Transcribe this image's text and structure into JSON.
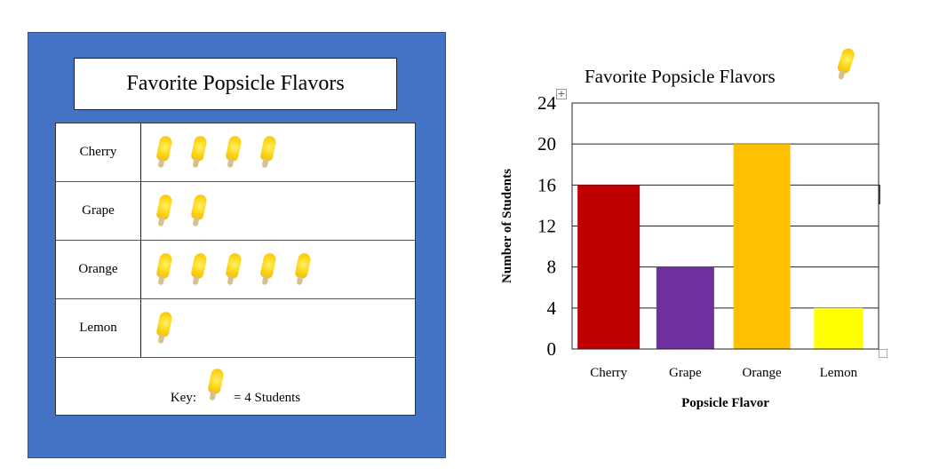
{
  "pictograph": {
    "title": "Favorite Popsicle Flavors",
    "background_color": "#4472c4",
    "icon": "popsicle-icon",
    "rows": [
      {
        "label": "Cherry",
        "icons": 4
      },
      {
        "label": "Grape",
        "icons": 2
      },
      {
        "label": "Orange",
        "icons": 5
      },
      {
        "label": "Lemon",
        "icons": 1
      }
    ],
    "key_prefix": "Key:",
    "key_suffix": "= 4 Students"
  },
  "chart_data": {
    "type": "bar",
    "title": "Favorite Popsicle Flavors",
    "title_icon": "popsicle-icon",
    "categories": [
      "Cherry",
      "Grape",
      "Orange",
      "Lemon"
    ],
    "values": [
      16,
      8,
      20,
      4
    ],
    "colors": [
      "#c00000",
      "#7030a0",
      "#ffc000",
      "#ffff00"
    ],
    "xlabel": "Popsicle Flavor",
    "ylabel": "Number of Students",
    "ylim": [
      0,
      24
    ],
    "yticks": [
      0,
      4,
      8,
      12,
      16,
      20,
      24
    ],
    "grid": true,
    "legend": "none"
  }
}
